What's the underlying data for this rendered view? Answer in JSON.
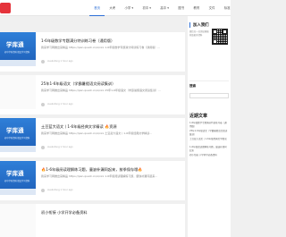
{
  "header": {
    "nav": [
      {
        "label": "首页",
        "active": true
      },
      {
        "label": "大考"
      },
      {
        "label": "小学 ▾"
      },
      {
        "label": "初中 ▾"
      },
      {
        "label": "高中 ▾"
      },
      {
        "label": "图书"
      },
      {
        "label": "教育"
      },
      {
        "label": "文件"
      },
      {
        "label": "标准自主学习"
      }
    ]
  },
  "posts": [
    {
      "thumb_title": "学库通",
      "thumb_sub": "初中学科资料 精品学习资料",
      "title": "1-6年级数学专题满分特训练习卷（通用版）",
      "excerpt": "我来学习网推出来精品 https://pan.quark.cn/s/xxx 1-6年级数学专题满分特训练习卷（通用版）…",
      "meta": "xuekutong  1 hour ago"
    },
    {
      "thumb_title": "",
      "thumb_sub": "",
      "title": "25年1-6年级语文（学霸暑假语文阅读集训）",
      "excerpt": "我来学习网推出来精品 https://pan.quark.cn/s/xxx 25年1-6年级语文（学霸暑假语文阅读集训）…",
      "meta": "xuekutong  1 hour ago"
    },
    {
      "thumb_title": "学库通",
      "thumb_sub": "初中学科资料 精品学习资料",
      "title": "土豆蓝大语文丨1-6年级经典文学精读 🔥资源",
      "excerpt": "我来学习网推出来精品 https://pan.quark.cn/s/xxx 土豆蓝大语文丨1-6年级经典文学精读…",
      "meta": "xuekutong  1 hour ago"
    },
    {
      "thumb_title": "学库通",
      "thumb_sub": "初中学科资料 精品学习资料",
      "title": "🔥1-6年级阅读理解练习题，童缺补漏同起来，按季保存哦🔥",
      "excerpt": "我来学习网推出来精品 https://pan.quark.cn/s/xxx 1-6年级阅读理解练习题，童缺补漏同起来…",
      "meta": "xuekutong  1 hour ago"
    },
    {
      "thumb_title": "",
      "thumb_sub": "",
      "title": "初小衔接 小学开学必备资料",
      "excerpt": "",
      "meta": ""
    }
  ],
  "sidebar": {
    "join_title": "加入我们",
    "join_text": "微信扫一扫添加客服 获取更多资料",
    "search_title": "搜索",
    "recent_title": "近期文章",
    "recent": [
      "1-6年级数学专题满分特训练习卷（通用版）",
      "25年1-6年级语文（学霸暑假语文阅读集训）",
      "土豆蓝大语文丨1-6年级经典文学精读",
      "1-6年级阅读理解练习题，童缺补漏同起来",
      "初小衔接 小学开学必备资料"
    ]
  }
}
